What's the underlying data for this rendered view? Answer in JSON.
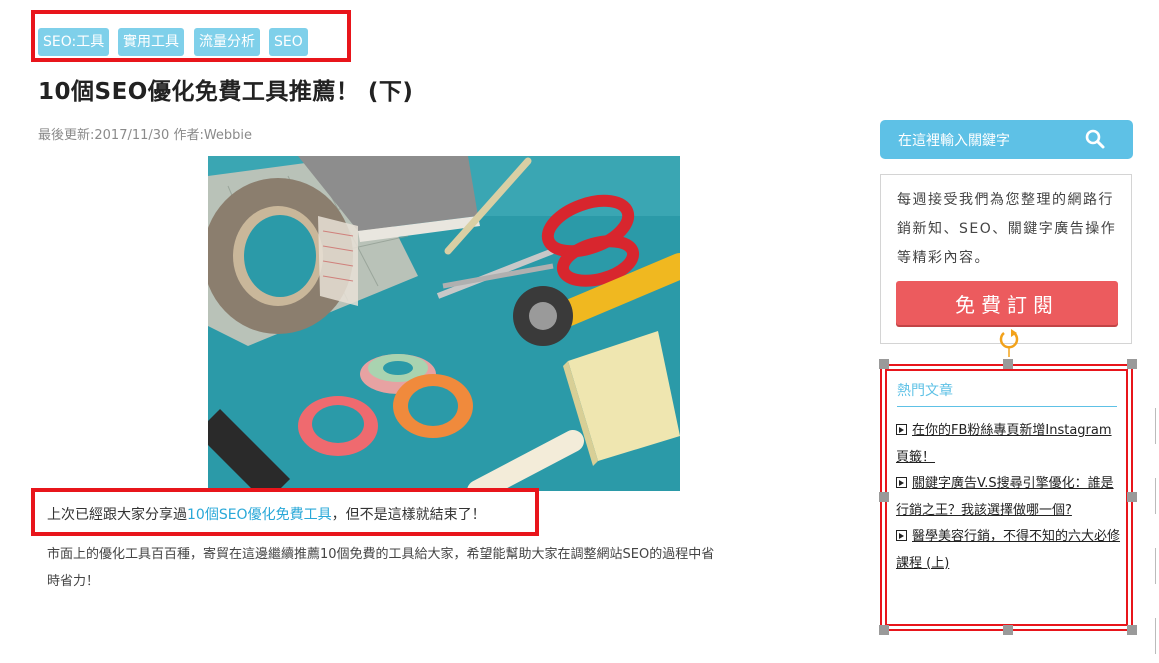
{
  "article": {
    "tags": [
      "SEO:工具",
      "實用工具",
      "流量分析",
      "SEO"
    ],
    "title": "10個SEO優化免費工具推薦！ (下)",
    "meta": "最後更新:2017/11/30 作者:Webbie",
    "intro_prefix": "上次已經跟大家分享過",
    "intro_link": "10個SEO優化免費工具",
    "intro_suffix": "，但不是這樣就結束了！",
    "body_line1": "市面上的優化工具百百種，寄貿在這邊繼續推薦10個免費的工具給大家，希望能幫助大家在調整網站SEO的過程中省",
    "body_line2": "時省力！"
  },
  "sidebar": {
    "search_placeholder": "在這裡輸入關鍵字",
    "subscribe_text": "每週接受我們為您整理的網路行銷新知、SEO、關鍵字廣告操作等精彩內容。",
    "subscribe_button": "免費訂閱",
    "popular_title": "熱門文章",
    "popular_items": [
      "在你的FB粉絲專頁新增Instagram頁籤！",
      "關鍵字廣告V.S搜尋引擎優化：誰是行銷之王？我該選擇做哪一個?",
      "醫學美容行銷，不得不知的六大必修課程 (上)"
    ]
  },
  "colors": {
    "tag_bg": "#7fd0ea",
    "accent": "#5ec1e6",
    "highlight_border": "#e8151b",
    "subscribe_button": "#ec5b5e",
    "rotate_handle": "#f2a21b"
  }
}
